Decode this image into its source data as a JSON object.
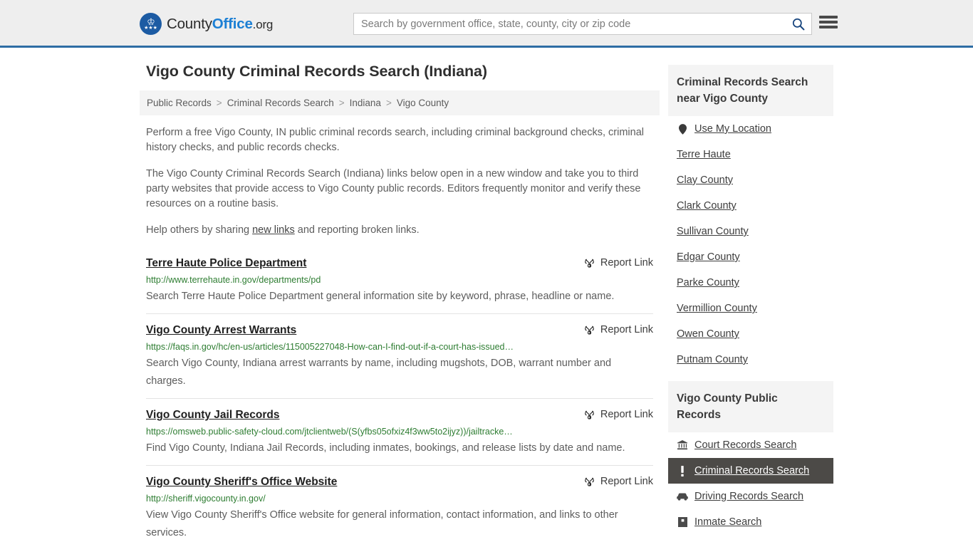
{
  "header": {
    "brand": {
      "part1": "County",
      "part2": "Office",
      "part3": ".org"
    },
    "search": {
      "placeholder": "Search by government office, state, county, city or zip code",
      "value": "",
      "search_icon": "search-icon"
    },
    "menu_icon": "hamburger-menu-icon"
  },
  "page": {
    "title": "Vigo County Criminal Records Search (Indiana)",
    "breadcrumb": [
      {
        "label": "Public Records",
        "current": false
      },
      {
        "label": "Criminal Records Search",
        "current": false
      },
      {
        "label": "Indiana",
        "current": false
      },
      {
        "label": "Vigo County",
        "current": true
      }
    ],
    "breadcrumb_separator": ">",
    "intro": [
      "Perform a free Vigo County, IN public criminal records search, including criminal background checks, criminal history checks, and public records checks.",
      "The Vigo County Criminal Records Search (Indiana) links below open in a new window and take you to third party websites that provide access to Vigo County public records. Editors frequently monitor and verify these resources on a routine basis."
    ],
    "help_prefix": "Help others by sharing ",
    "help_link": "new links",
    "help_suffix": " and reporting broken links."
  },
  "results": {
    "report_label": "Report Link",
    "report_icon": "broken-link-icon",
    "items": [
      {
        "title": "Terre Haute Police Department",
        "url": "http://www.terrehaute.in.gov/departments/pd",
        "description": "Search Terre Haute Police Department general information site by keyword, phrase, headline or name."
      },
      {
        "title": "Vigo County Arrest Warrants",
        "url": "https://faqs.in.gov/hc/en-us/articles/115005227048-How-can-I-find-out-if-a-court-has-issued…",
        "description": "Search Vigo County, Indiana arrest warrants by name, including mugshots, DOB, warrant number and charges."
      },
      {
        "title": "Vigo County Jail Records",
        "url": "https://omsweb.public-safety-cloud.com/jtclientweb/(S(yfbs05ofxiz4f3ww5to2ijyz))/jailtracke…",
        "description": "Find Vigo County, Indiana Jail Records, including inmates, bookings, and release lists by date and name."
      },
      {
        "title": "Vigo County Sheriff's Office Website",
        "url": "http://sheriff.vigocounty.in.gov/",
        "description": "View Vigo County Sheriff's Office website for general information, contact information, and links to other services."
      }
    ]
  },
  "sidebar": {
    "nearby": {
      "heading": "Criminal Records Search near Vigo County",
      "items": [
        {
          "label": "Use My Location",
          "icon": "map-pin-icon"
        },
        {
          "label": "Terre Haute",
          "icon": ""
        },
        {
          "label": "Clay County",
          "icon": ""
        },
        {
          "label": "Clark County",
          "icon": ""
        },
        {
          "label": "Sullivan County",
          "icon": ""
        },
        {
          "label": "Edgar County",
          "icon": ""
        },
        {
          "label": "Parke County",
          "icon": ""
        },
        {
          "label": "Vermillion County",
          "icon": ""
        },
        {
          "label": "Owen County",
          "icon": ""
        },
        {
          "label": "Putnam County",
          "icon": ""
        }
      ]
    },
    "public_records": {
      "heading": "Vigo County Public Records",
      "items": [
        {
          "label": "Court Records Search",
          "icon": "bank-building-icon",
          "active": false
        },
        {
          "label": "Criminal Records Search",
          "icon": "exclamation-icon",
          "active": true
        },
        {
          "label": "Driving Records Search",
          "icon": "car-icon",
          "active": false
        },
        {
          "label": "Inmate Search",
          "icon": "jail-building-icon",
          "active": false
        }
      ]
    }
  },
  "colors": {
    "header_bg": "#eeeeee",
    "header_border": "#2e6da4",
    "brand_blue": "#1c7fd4",
    "url_green": "#2e7d32",
    "active_bg": "#4c4a47",
    "panel_bg": "#f4f4f4"
  }
}
